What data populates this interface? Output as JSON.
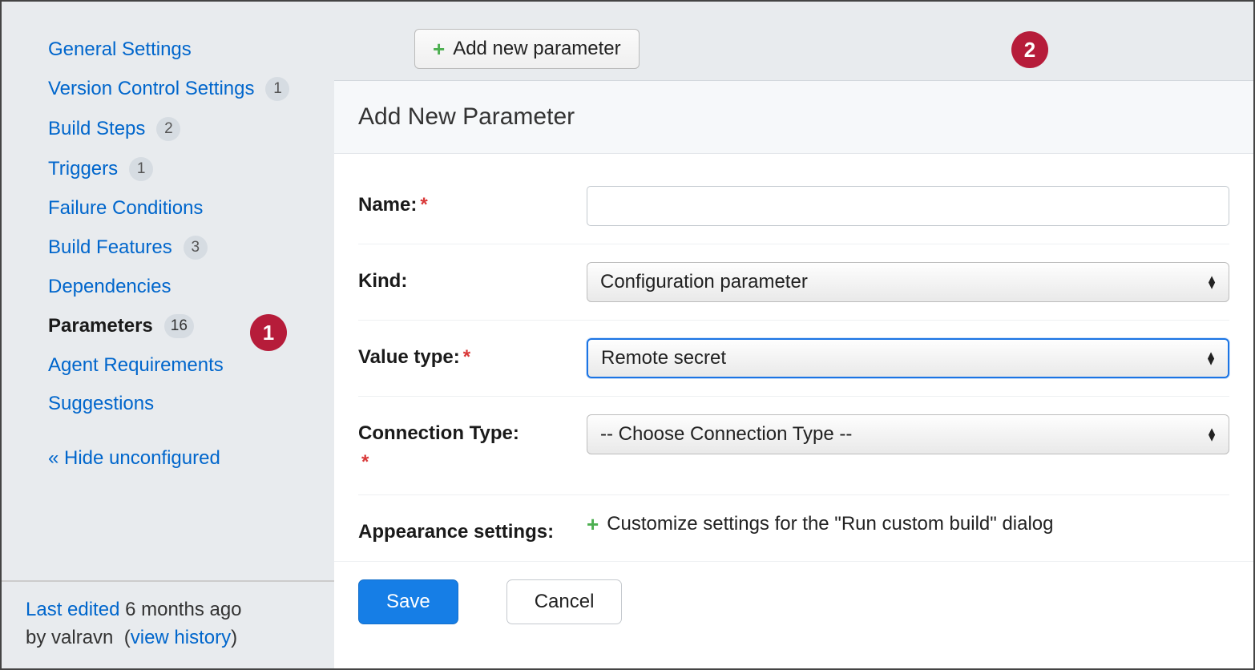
{
  "sidebar": {
    "items": [
      {
        "label": "General Settings",
        "count": null
      },
      {
        "label": "Version Control Settings",
        "count": "1"
      },
      {
        "label": "Build Steps",
        "count": "2"
      },
      {
        "label": "Triggers",
        "count": "1"
      },
      {
        "label": "Failure Conditions",
        "count": null
      },
      {
        "label": "Build Features",
        "count": "3"
      },
      {
        "label": "Dependencies",
        "count": null
      },
      {
        "label": "Parameters",
        "count": "16",
        "active": true
      },
      {
        "label": "Agent Requirements",
        "count": null
      },
      {
        "label": "Suggestions",
        "count": null
      }
    ],
    "hide_unconfigured": "« Hide unconfigured",
    "footer": {
      "last_edited_label": "Last edited",
      "time_ago": "6 months ago",
      "by_label": "by",
      "user": "valravn",
      "view_history": "view history"
    }
  },
  "main": {
    "add_button": "Add new parameter",
    "dialog_title": "Add New Parameter",
    "form": {
      "name_label": "Name:",
      "name_value": "",
      "kind_label": "Kind:",
      "kind_value": "Configuration parameter",
      "value_type_label": "Value type:",
      "value_type_value": "Remote secret",
      "connection_type_label": "Connection Type:",
      "connection_type_value": "-- Choose Connection Type --",
      "appearance_label": "Appearance settings:",
      "appearance_text": "Customize settings for the \"Run custom build\" dialog"
    },
    "save_label": "Save",
    "cancel_label": "Cancel"
  },
  "callouts": {
    "c1": "1",
    "c2": "2"
  }
}
